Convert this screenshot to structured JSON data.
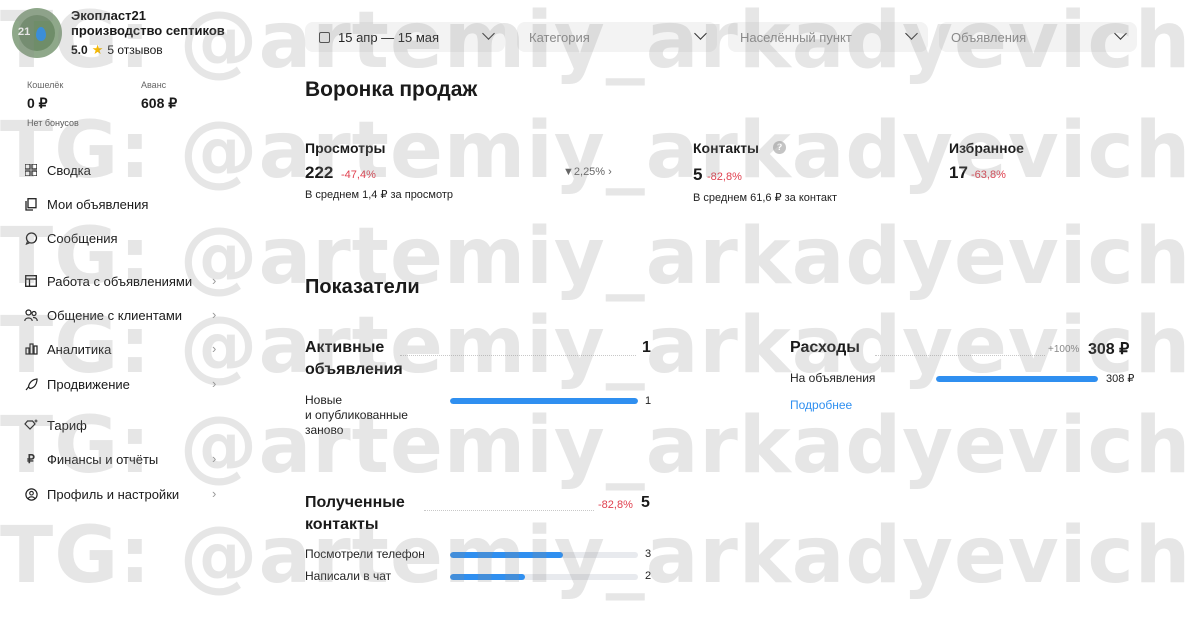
{
  "company": {
    "name": "Экопласт21",
    "subtitle": "производство септиков",
    "rating": "5.0",
    "reviews": "5 отзывов",
    "logo_number": "21"
  },
  "wallet": {
    "label": "Кошелёк",
    "value": "0 ₽"
  },
  "advance": {
    "label": "Аванс",
    "value": "608 ₽"
  },
  "bonus_note": "Нет бонусов",
  "nav": [
    {
      "label": "Сводка",
      "icon": "grid-icon"
    },
    {
      "label": "Мои объявления",
      "icon": "copy-icon"
    },
    {
      "label": "Сообщения",
      "icon": "chat-icon"
    },
    {
      "label": "Работа с объявлениями",
      "icon": "window-icon"
    },
    {
      "label": "Общение с клиентами",
      "icon": "people-icon"
    },
    {
      "label": "Аналитика",
      "icon": "bar-chart-icon"
    },
    {
      "label": "Продвижение",
      "icon": "rocket-icon"
    },
    {
      "label": "Тариф",
      "icon": "sparkle-icon"
    },
    {
      "label": "Финансы и отчёты",
      "icon": "ruble-icon"
    },
    {
      "label": "Профиль и настройки",
      "icon": "user-circle-icon"
    }
  ],
  "filters": {
    "date": "15 апр — 15 мая",
    "category": "Категория",
    "location": "Населённый пункт",
    "ads": "Объявления"
  },
  "funnel": {
    "title": "Воронка продаж",
    "views": {
      "title": "Просмотры",
      "value": "222",
      "delta": "-47,4%",
      "note": "В среднем 1,4 ₽ за просмотр"
    },
    "conversion": "2,25%",
    "contacts": {
      "title": "Контакты",
      "value": "5",
      "delta": "-82,8%",
      "note": "В среднем 61,6 ₽ за контакт"
    },
    "favorites": {
      "title": "Избранное",
      "value": "17",
      "delta": "-63,8%"
    }
  },
  "indicators": {
    "title": "Показатели",
    "active_ads": {
      "title_1": "Активные",
      "title_2": "объявления",
      "value": "1",
      "rows": [
        {
          "label_1": "Новые",
          "label_2": "и опубликованные",
          "label_3": "заново",
          "value": "1",
          "fill": 1.0
        }
      ]
    },
    "expenses": {
      "title": "Расходы",
      "delta": "+100%",
      "value": "308 ₽",
      "rows": [
        {
          "label": "На объявления",
          "value": "308 ₽",
          "fill": 1.0
        }
      ],
      "link": "Подробнее"
    },
    "contacts": {
      "title_1": "Полученные",
      "title_2": "контакты",
      "delta": "-82,8%",
      "value": "5",
      "rows": [
        {
          "label": "Посмотрели телефон",
          "value": "3",
          "fill": 0.6
        },
        {
          "label": "Написали в чат",
          "value": "2",
          "fill": 0.4
        }
      ]
    }
  },
  "watermark": "TG: @artemiy_arkadyevich",
  "colors": {
    "accent": "#2f8ff0",
    "negative": "#e0404f",
    "star": "#f5b800"
  }
}
